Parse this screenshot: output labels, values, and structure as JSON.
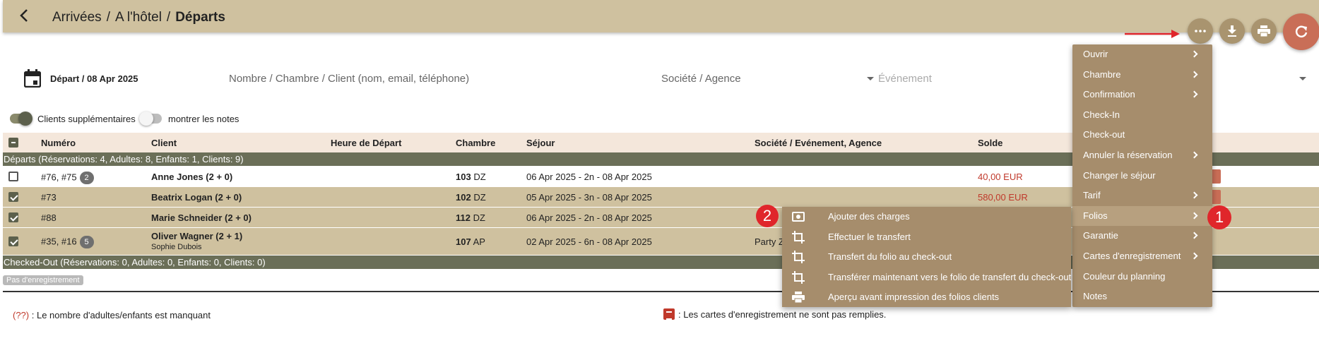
{
  "header": {
    "breadcrumb": [
      "Arrivées",
      "A l'hôtel",
      "Départs"
    ],
    "separator": "/"
  },
  "toolbar": {
    "more_icon": "more-horiz-icon",
    "download_icon": "download-icon",
    "print_icon": "print-icon",
    "refresh_icon": "refresh-icon"
  },
  "filters": {
    "date_label": "Départ / 08 Apr 2025",
    "search_placeholder": "Nombre / Chambre / Client (nom, email, téléphone)",
    "company_placeholder": "Société / Agence",
    "event_placeholder": "Événement"
  },
  "toggles": {
    "extra_clients": {
      "label": "Clients supplémentaires",
      "on": true
    },
    "show_notes": {
      "label": "montrer les notes",
      "on": false
    }
  },
  "table": {
    "columns": [
      "Numéro",
      "Client",
      "Heure de Départ",
      "Chambre",
      "Séjour",
      "Société / Evénement, Agence",
      "Solde"
    ],
    "group_departs": "Départs (Réservations: 4, Adultes: 8, Enfants: 1, Clients: 9)",
    "group_checked_out": "Checked-Out (Réservations: 0, Adultes: 0, Enfants: 0, Clients: 0)",
    "no_registration_badge": "Pas d'enregistrement",
    "rows": [
      {
        "number": "#76, #75",
        "count": "2",
        "client": "Anne Jones (2 + 0)",
        "sub": "",
        "room": "103",
        "room_type": "DZ",
        "stay": "06 Apr 2025 - 2n - 08 Apr 2025",
        "company": "",
        "balance": "40,00 EUR",
        "checked": false
      },
      {
        "number": "#73",
        "count": "",
        "client": "Beatrix Logan (2 + 0)",
        "sub": "",
        "room": "102",
        "room_type": "DZ",
        "stay": "05 Apr 2025 - 3n - 08 Apr 2025",
        "company": "",
        "balance": "580,00 EUR",
        "checked": true
      },
      {
        "number": "#88",
        "count": "",
        "client": "Marie Schneider (2 + 0)",
        "sub": "",
        "room": "112",
        "room_type": "DZ",
        "stay": "06 Apr 2025 - 2n - 08 Apr 2025",
        "company": "",
        "balance": "",
        "checked": true
      },
      {
        "number": "#35, #16",
        "count": "5",
        "client": "Oliver Wagner (2 + 1)",
        "sub": "Sophie Dubois",
        "room": "107",
        "room_type": "AP",
        "stay": "02 Apr 2025 - 6n - 08 Apr 2025",
        "company": "Party Z",
        "balance": "",
        "checked": true
      }
    ]
  },
  "legend": {
    "missing_mark": "(??)",
    "missing_text": ": Le nombre d'adultes/enfants est manquant",
    "cards_text": ": Les cartes d'enregistrement ne sont pas remplies."
  },
  "menu": {
    "items": [
      {
        "label": "Ouvrir",
        "submenu": true
      },
      {
        "label": "Chambre",
        "submenu": true
      },
      {
        "label": "Confirmation",
        "submenu": true
      },
      {
        "label": "Check-In",
        "submenu": false
      },
      {
        "label": "Check-out",
        "submenu": false
      },
      {
        "label": "Annuler la réservation",
        "submenu": true
      },
      {
        "label": "Changer le séjour",
        "submenu": false
      },
      {
        "label": "Tarif",
        "submenu": true
      },
      {
        "label": "Folios",
        "submenu": true
      },
      {
        "label": "Garantie",
        "submenu": true
      },
      {
        "label": "Cartes d'enregistrement",
        "submenu": true
      },
      {
        "label": "Couleur du planning",
        "submenu": false
      },
      {
        "label": "Notes",
        "submenu": false
      }
    ],
    "active_index": 8
  },
  "submenu": {
    "items": [
      {
        "label": "Ajouter des charges",
        "icon": "add-charges-icon"
      },
      {
        "label": "Effectuer le transfert",
        "icon": "crop-icon"
      },
      {
        "label": "Transfert du folio au check-out",
        "icon": "crop-icon"
      },
      {
        "label": "Transférer maintenant vers le folio de transfert du check-out",
        "icon": "crop-icon"
      },
      {
        "label": "Aperçu avant impression des folios clients",
        "icon": "print-icon"
      }
    ]
  },
  "annotations": {
    "badge1": "1",
    "badge2": "2"
  },
  "colors": {
    "header_bg": "#cfc19f",
    "menu_bg": "#a68d6c",
    "accent_red": "#c96e57",
    "group_bg": "#6b6f58"
  }
}
